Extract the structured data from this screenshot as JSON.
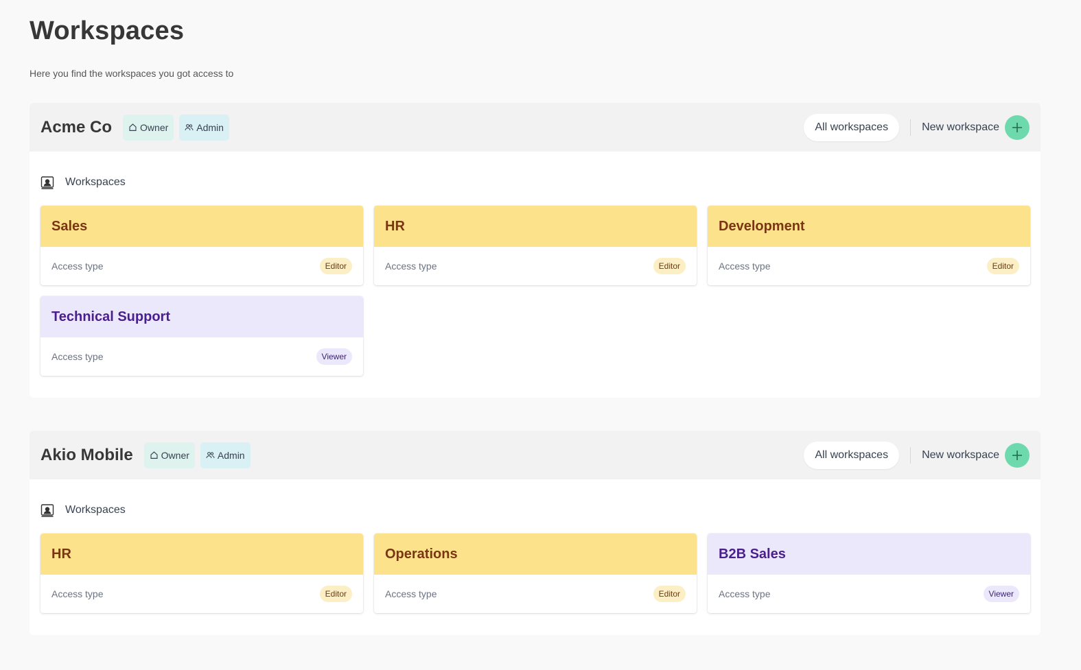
{
  "page": {
    "title": "Workspaces",
    "subtitle": "Here you find the workspaces you got access to"
  },
  "colors": {
    "editor_header": "#fce38b",
    "viewer_header": "#ebe8fc",
    "add_button": "#6fd9ae"
  },
  "orgs": [
    {
      "name": "Acme Co",
      "roles": [
        "Owner",
        "Admin"
      ],
      "all_workspaces_label": "All workspaces",
      "new_workspace_label": "New workspace",
      "section_label": "Workspaces",
      "access_label": "Access type",
      "workspaces": [
        {
          "name": "Sales",
          "access": "Editor"
        },
        {
          "name": "HR",
          "access": "Editor"
        },
        {
          "name": "Development",
          "access": "Editor"
        },
        {
          "name": "Technical Support",
          "access": "Viewer"
        }
      ]
    },
    {
      "name": "Akio Mobile",
      "roles": [
        "Owner",
        "Admin"
      ],
      "all_workspaces_label": "All workspaces",
      "new_workspace_label": "New workspace",
      "section_label": "Workspaces",
      "access_label": "Access type",
      "workspaces": [
        {
          "name": "HR",
          "access": "Editor"
        },
        {
          "name": "Operations",
          "access": "Editor"
        },
        {
          "name": "B2B Sales",
          "access": "Viewer"
        }
      ]
    }
  ]
}
